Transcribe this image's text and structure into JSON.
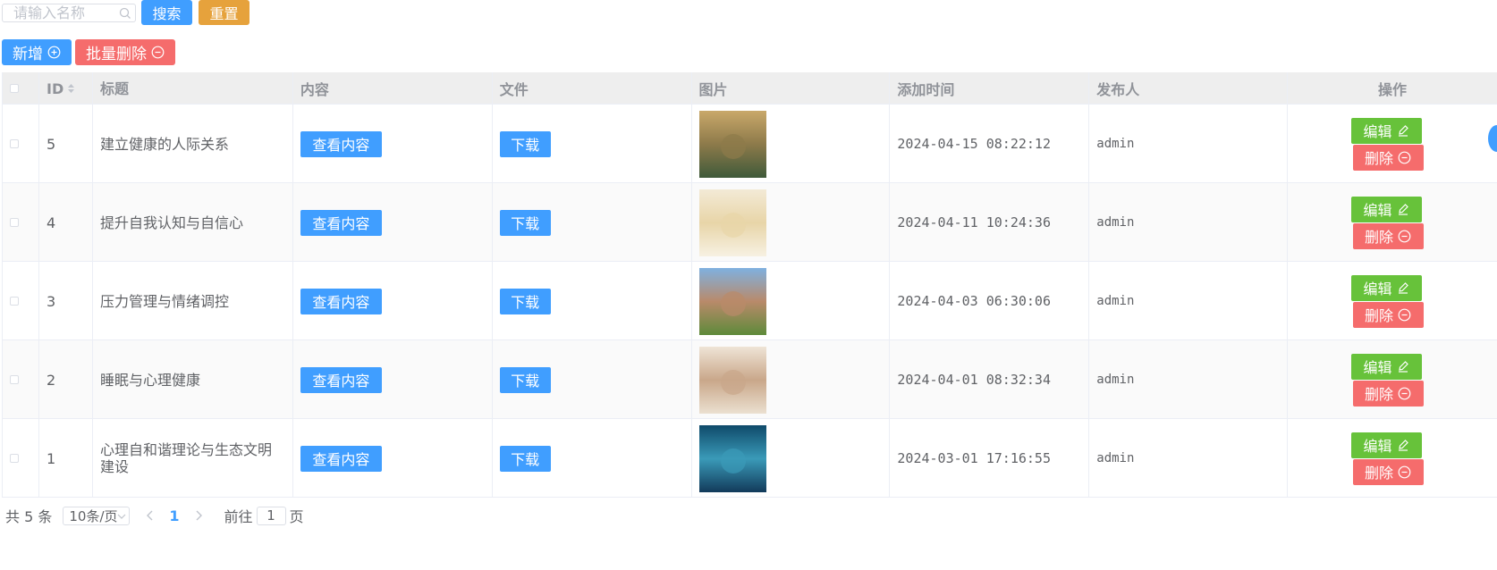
{
  "search": {
    "placeholder": "请输入名称",
    "search_label": "搜索",
    "reset_label": "重置"
  },
  "actions": {
    "add_label": "新增",
    "batch_delete_label": "批量删除"
  },
  "table": {
    "headers": {
      "id": "ID",
      "title": "标题",
      "content": "内容",
      "file": "文件",
      "image": "图片",
      "time": "添加时间",
      "publisher": "发布人",
      "op": "操作"
    },
    "rows": [
      {
        "id": "5",
        "title": "建立健康的人际关系",
        "view_label": "查看内容",
        "download_label": "下载",
        "time": "2024-04-15 08:22:12",
        "publisher": "admin",
        "edit_label": "编辑",
        "delete_label": "删除",
        "thumb": {
          "top": "#c9a86a",
          "mid": "#8d7a4a",
          "bottom": "#3f5a3a"
        }
      },
      {
        "id": "4",
        "title": "提升自我认知与自信心",
        "view_label": "查看内容",
        "download_label": "下载",
        "time": "2024-04-11 10:24:36",
        "publisher": "admin",
        "edit_label": "编辑",
        "delete_label": "删除",
        "thumb": {
          "top": "#f3ead6",
          "mid": "#e8d5a8",
          "bottom": "#f7f1e2"
        }
      },
      {
        "id": "3",
        "title": "压力管理与情绪调控",
        "view_label": "查看内容",
        "download_label": "下载",
        "time": "2024-04-03 06:30:06",
        "publisher": "admin",
        "edit_label": "编辑",
        "delete_label": "删除",
        "thumb": {
          "top": "#7fb1e0",
          "mid": "#b98a6a",
          "bottom": "#5d8a3a"
        }
      },
      {
        "id": "2",
        "title": "睡眠与心理健康",
        "view_label": "查看内容",
        "download_label": "下载",
        "time": "2024-04-01 08:32:34",
        "publisher": "admin",
        "edit_label": "编辑",
        "delete_label": "删除",
        "thumb": {
          "top": "#efe4d6",
          "mid": "#c9a78a",
          "bottom": "#ebe0d0"
        }
      },
      {
        "id": "1",
        "title": "心理自和谐理论与生态文明建设",
        "view_label": "查看内容",
        "download_label": "下载",
        "time": "2024-03-01 17:16:55",
        "publisher": "admin",
        "edit_label": "编辑",
        "delete_label": "删除",
        "thumb": {
          "top": "#0f4a6a",
          "mid": "#3a9ab8",
          "bottom": "#123a5a"
        }
      }
    ]
  },
  "pager": {
    "total_prefix": "共 5 条",
    "page_size": "10条/页",
    "current_page": "1",
    "goto_label": "前往",
    "goto_value": "1",
    "page_suffix": "页"
  },
  "colors": {
    "primary": "#409eff",
    "warning": "#e6a23c",
    "danger": "#f56c6c",
    "success": "#67c23a"
  }
}
